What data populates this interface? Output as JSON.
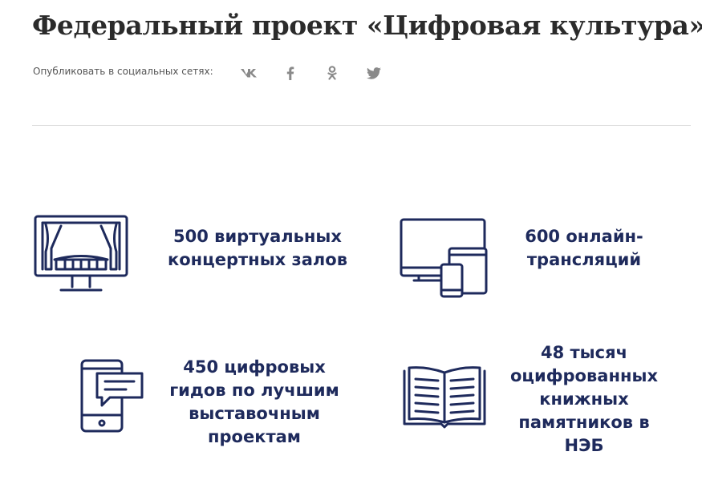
{
  "header": {
    "title": "Федеральный проект «Цифровая культура»"
  },
  "share": {
    "label": "Опубликовать в социальных сетях:",
    "networks": [
      {
        "name": "vk",
        "icon": "vk-icon"
      },
      {
        "name": "facebook",
        "icon": "facebook-icon"
      },
      {
        "name": "odnoklassniki",
        "icon": "odnoklassniki-icon"
      },
      {
        "name": "twitter",
        "icon": "twitter-icon"
      }
    ]
  },
  "colors": {
    "accent": "#1e2a5c",
    "social_icon": "#8a8a8a",
    "divider": "#dcdcdc",
    "title": "#2b2b2b"
  },
  "stats": [
    {
      "icon": "theater-screen-icon",
      "text": "500 виртуальных\nконцертных залов"
    },
    {
      "icon": "devices-icon",
      "text": "600 онлайн-\nтрансляций"
    },
    {
      "icon": "phone-chat-icon",
      "text": "450 цифровых\nгидов по лучшим\nвыставочным\nпроектам"
    },
    {
      "icon": "open-book-icon",
      "text": "48 тысяч\nоцифрованных\nкнижных\nпамятников в\nНЭБ"
    }
  ]
}
